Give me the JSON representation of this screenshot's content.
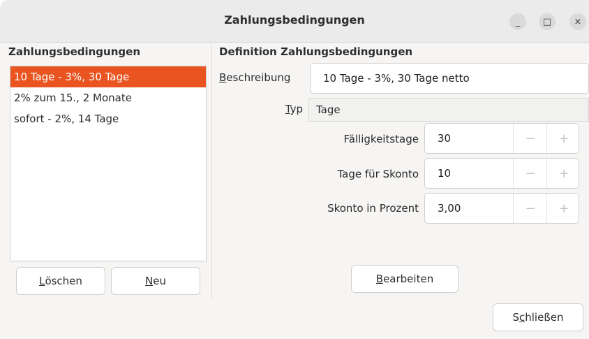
{
  "window": {
    "title": "Zahlungsbedingungen",
    "controls": {
      "minimize": "_",
      "maximize": "□",
      "close": "×"
    }
  },
  "left": {
    "heading": "Zahlungsbedingungen",
    "items": [
      {
        "label": "10 Tage - 3%, 30 Tage",
        "selected": true
      },
      {
        "label": "2% zum 15., 2 Monate",
        "selected": false
      },
      {
        "label": "sofort  -  2%, 14 Tage",
        "selected": false
      }
    ],
    "delete_button": {
      "mnemonic": "L",
      "rest": "öschen"
    },
    "new_button": {
      "mnemonic": "N",
      "rest": "eu"
    }
  },
  "right": {
    "heading": "Definition Zahlungsbedingungen",
    "description": {
      "label_mnemonic": "B",
      "label_rest": "eschreibung",
      "value": "10 Tage - 3%, 30 Tage netto"
    },
    "type": {
      "label_mnemonic": "T",
      "label_rest": "yp",
      "value": "Tage"
    },
    "due_days": {
      "label": "Fälligkeitstage",
      "value": "30"
    },
    "discount_days": {
      "label": "Tage für Skonto",
      "value": "10"
    },
    "discount_percent": {
      "label": "Skonto in Prozent",
      "value": "3,00"
    },
    "spin_minus": "−",
    "spin_plus": "+",
    "edit_button": {
      "mnemonic": "B",
      "rest": "earbeiten"
    }
  },
  "close_button": {
    "before": "S",
    "mnemonic": "c",
    "rest": "hließen"
  },
  "colors": {
    "accent": "#e95420"
  }
}
